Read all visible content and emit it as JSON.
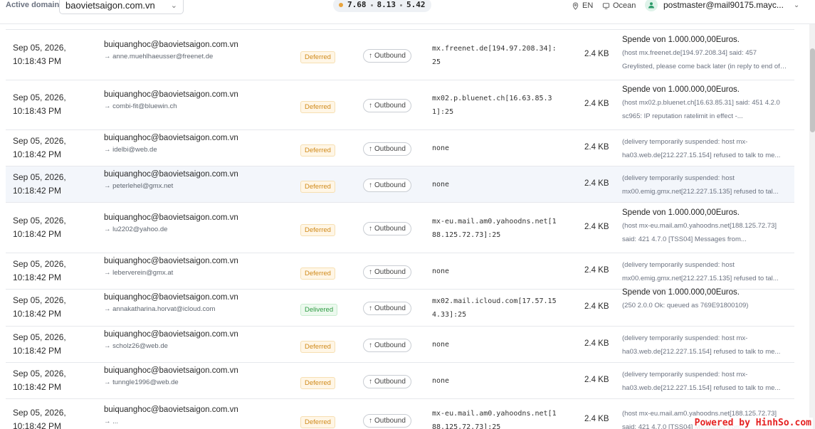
{
  "topbar": {
    "domain_label": "Active domain",
    "domain_value": "baovietsaigon.com.vn",
    "load": [
      "7.68",
      "8.13",
      "5.42"
    ],
    "language": "EN",
    "theme": "Ocean",
    "user": "postmaster@mail90175.mayc..."
  },
  "rows": [
    {
      "date": "Sep 05, 2026,",
      "time": "10:18:43 PM",
      "from": "buiquanghoc@baovietsaigon.com.vn",
      "to": "→ anne.muehlhaeusser@freenet.de",
      "status": "Deferred",
      "direction": "Outbound",
      "mx": "mx.freenet.de[194.97.208.34]:25",
      "size": "2.4 KB",
      "resp_title": "Spende von 1.000.000,00Euros.",
      "resp_text": "(host mx.freenet.de[194.97.208.34] said: 457 Greylisted, please come back later (in reply to end of DATA command))"
    },
    {
      "date": "Sep 05, 2026,",
      "time": "10:18:43 PM",
      "from": "buiquanghoc@baovietsaigon.com.vn",
      "to": "→ combi-fit@bluewin.ch",
      "status": "Deferred",
      "direction": "Outbound",
      "mx": "mx02.p.bluenet.ch[16.63.85.31]:25",
      "size": "2.4 KB",
      "resp_title": "Spende von 1.000.000,00Euros.",
      "resp_text": "(host mx02.p.bluenet.ch[16.63.85.31] said: 451 4.2.0 sc965: IP reputation ratelimit in effect -..."
    },
    {
      "date": "Sep 05, 2026,",
      "time": "10:18:42 PM",
      "from": "buiquanghoc@baovietsaigon.com.vn",
      "to": "→ idelbi@web.de",
      "status": "Deferred",
      "direction": "Outbound",
      "mx": "none",
      "size": "2.4 KB",
      "resp_title": "",
      "resp_text": "(delivery temporarily suspended: host mx-ha03.web.de[212.227.15.154] refused to talk to me..."
    },
    {
      "date": "Sep 05, 2026,",
      "time": "10:18:42 PM",
      "from": "buiquanghoc@baovietsaigon.com.vn",
      "to": "→ peterlehel@gmx.net",
      "status": "Deferred",
      "direction": "Outbound",
      "mx": "none",
      "size": "2.4 KB",
      "resp_title": "",
      "resp_text": "(delivery temporarily suspended: host mx00.emig.gmx.net[212.227.15.135] refused to tal..."
    },
    {
      "date": "Sep 05, 2026,",
      "time": "10:18:42 PM",
      "from": "buiquanghoc@baovietsaigon.com.vn",
      "to": "→ lu2202@yahoo.de",
      "status": "Deferred",
      "direction": "Outbound",
      "mx": "mx-eu.mail.am0.yahoodns.net[188.125.72.73]:25",
      "size": "2.4 KB",
      "resp_title": "Spende von 1.000.000,00Euros.",
      "resp_text": "(host mx-eu.mail.am0.yahoodns.net[188.125.72.73] said: 421 4.7.0 [TSS04] Messages from..."
    },
    {
      "date": "Sep 05, 2026,",
      "time": "10:18:42 PM",
      "from": "buiquanghoc@baovietsaigon.com.vn",
      "to": "→ leberverein@gmx.at",
      "status": "Deferred",
      "direction": "Outbound",
      "mx": "none",
      "size": "2.4 KB",
      "resp_title": "",
      "resp_text": "(delivery temporarily suspended: host mx00.emig.gmx.net[212.227.15.135] refused to tal..."
    },
    {
      "date": "Sep 05, 2026,",
      "time": "10:18:42 PM",
      "from": "buiquanghoc@baovietsaigon.com.vn",
      "to": "→ annakatharina.horvat@icloud.com",
      "status": "Delivered",
      "direction": "Outbound",
      "mx": "mx02.mail.icloud.com[17.57.154.33]:25",
      "size": "2.4 KB",
      "resp_title": "Spende von 1.000.000,00Euros.",
      "resp_text": "(250 2.0.0 Ok: queued as 769E91800109)"
    },
    {
      "date": "Sep 05, 2026,",
      "time": "10:18:42 PM",
      "from": "buiquanghoc@baovietsaigon.com.vn",
      "to": "→ scholz26@web.de",
      "status": "Deferred",
      "direction": "Outbound",
      "mx": "none",
      "size": "2.4 KB",
      "resp_title": "",
      "resp_text": "(delivery temporarily suspended: host mx-ha03.web.de[212.227.15.154] refused to talk to me..."
    },
    {
      "date": "Sep 05, 2026,",
      "time": "10:18:42 PM",
      "from": "buiquanghoc@baovietsaigon.com.vn",
      "to": "→ tunngle1996@web.de",
      "status": "Deferred",
      "direction": "Outbound",
      "mx": "none",
      "size": "2.4 KB",
      "resp_title": "",
      "resp_text": "(delivery temporarily suspended: host mx-ha03.web.de[212.227.15.154] refused to talk to me..."
    },
    {
      "date": "Sep 05, 2026,",
      "time": "10:18:42 PM",
      "from": "buiquanghoc@baovietsaigon.com.vn",
      "to": "→ ...",
      "status": "Deferred",
      "direction": "Outbound",
      "mx": "mx-eu.mail.am0.yahoodns.net[188.125.72.73]:25",
      "size": "2.4 KB",
      "resp_title": "",
      "resp_text": "(host mx-eu.mail.am0.yahoodns.net[188.125.72.73] said: 421 4.7.0 [TSS04] Messages from..."
    }
  ],
  "watermark": "Powered by HinhSo.com"
}
